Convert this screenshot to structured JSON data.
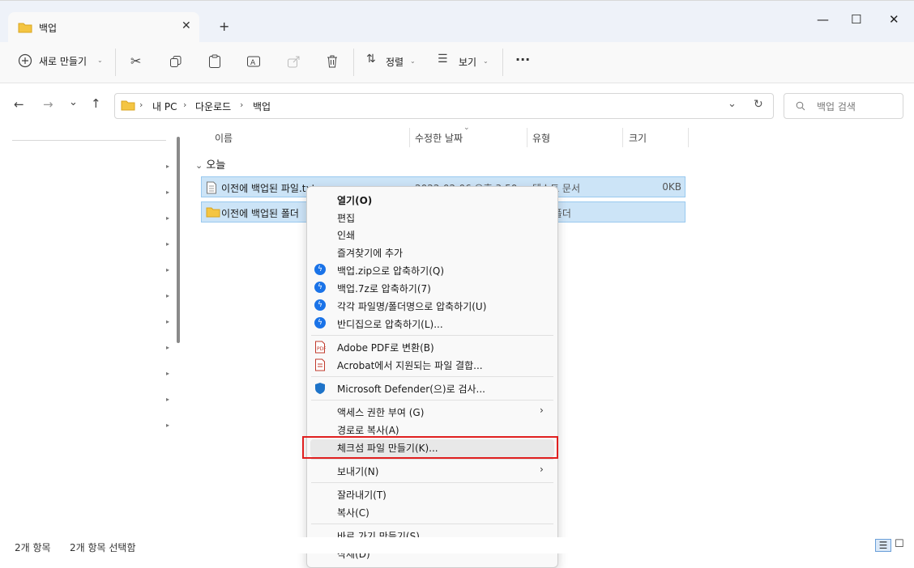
{
  "tab": {
    "title": "백업",
    "close": "✕"
  },
  "window": {
    "minimize": "—",
    "maximize": "☐",
    "close": "✕"
  },
  "toolbar": {
    "new_label": "새로 만들기",
    "sort_label": "정렬",
    "view_label": "보기",
    "more_label": "···"
  },
  "address": {
    "path": [
      "내 PC",
      "다운로드",
      "백업"
    ],
    "search_placeholder": "백업 검색"
  },
  "columns": {
    "name": "이름",
    "modified": "수정한 날짜",
    "type": "유형",
    "size": "크기"
  },
  "group": "오늘",
  "files": [
    {
      "name": "이전에 백업된 파일.txt",
      "date": "2022-02-06 오후 3:50",
      "type": "텍스트 문서",
      "size": "0KB"
    },
    {
      "name": "이전에 백업된 폴더",
      "date": "",
      "type": "파일 폴더",
      "size": ""
    }
  ],
  "context_menu": {
    "open": "열기(O)",
    "edit": "편집",
    "print": "인쇄",
    "favorite": "즐겨찾기에 추가",
    "zip": "백업.zip으로 압축하기(Q)",
    "sevenz": "백업.7z로 압축하기(7)",
    "each": "각각 파일명/폴더명으로 압축하기(U)",
    "bandizip": "반디집으로 압축하기(L)...",
    "pdf": "Adobe PDF로 변환(B)",
    "acrobat": "Acrobat에서 지원되는 파일 결합...",
    "defender": "Microsoft Defender(으)로 검사...",
    "access": "액세스 권한 부여 (G)",
    "copypath": "경로로 복사(A)",
    "checksum": "체크섬 파일 만들기(K)...",
    "sendto": "보내기(N)",
    "cut": "잘라내기(T)",
    "copy": "복사(C)",
    "shortcut": "바로 가기 만들기(S)",
    "delete": "삭제(D)"
  },
  "status": {
    "count": "2개 항목",
    "selected": "2개 항목 선택함"
  },
  "colors": {
    "selection": "#cce4f7",
    "highlight_box": "#e02020",
    "folder": "#f4c542"
  }
}
